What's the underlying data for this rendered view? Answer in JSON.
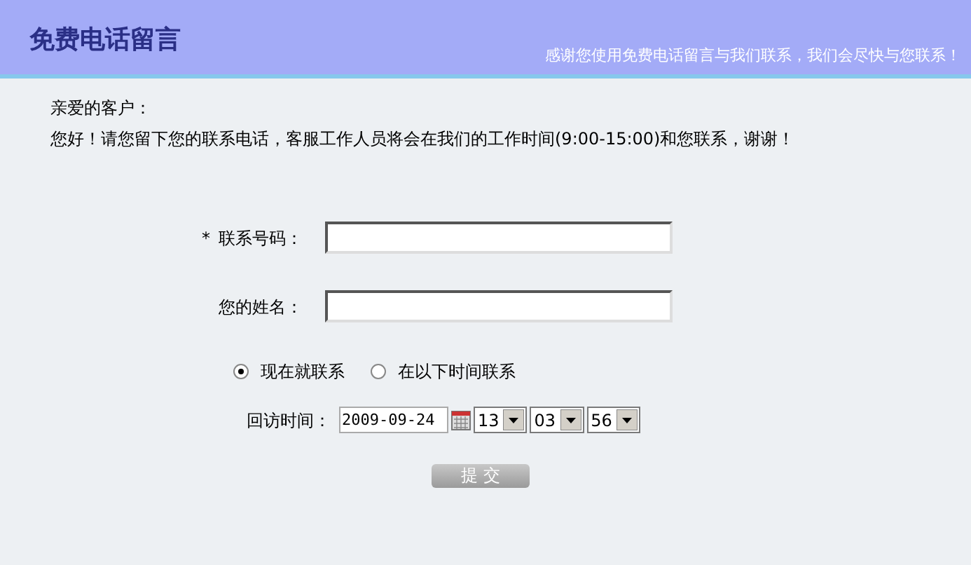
{
  "header": {
    "title": "免费电话留言",
    "subtitle": "感谢您使用免费电话留言与我们联系，我们会尽快与您联系！"
  },
  "greeting": "亲爱的客户：",
  "intro": "您好！请您留下您的联系电话，客服工作人员将会在我们的工作时间(9:00-15:00)和您联系，谢谢！",
  "fields": [
    {
      "label": "联系号码：",
      "required_mark": "*"
    },
    {
      "label": "您的姓名："
    }
  ],
  "contact_options": [
    {
      "label": "现在就联系",
      "selected": true
    },
    {
      "label": "在以下时间联系",
      "selected": false
    }
  ],
  "callback": {
    "label": "回访时间：",
    "date": "2009-09-24",
    "hour": "13",
    "minute": "03",
    "second": "56"
  },
  "submit": "提 交"
}
